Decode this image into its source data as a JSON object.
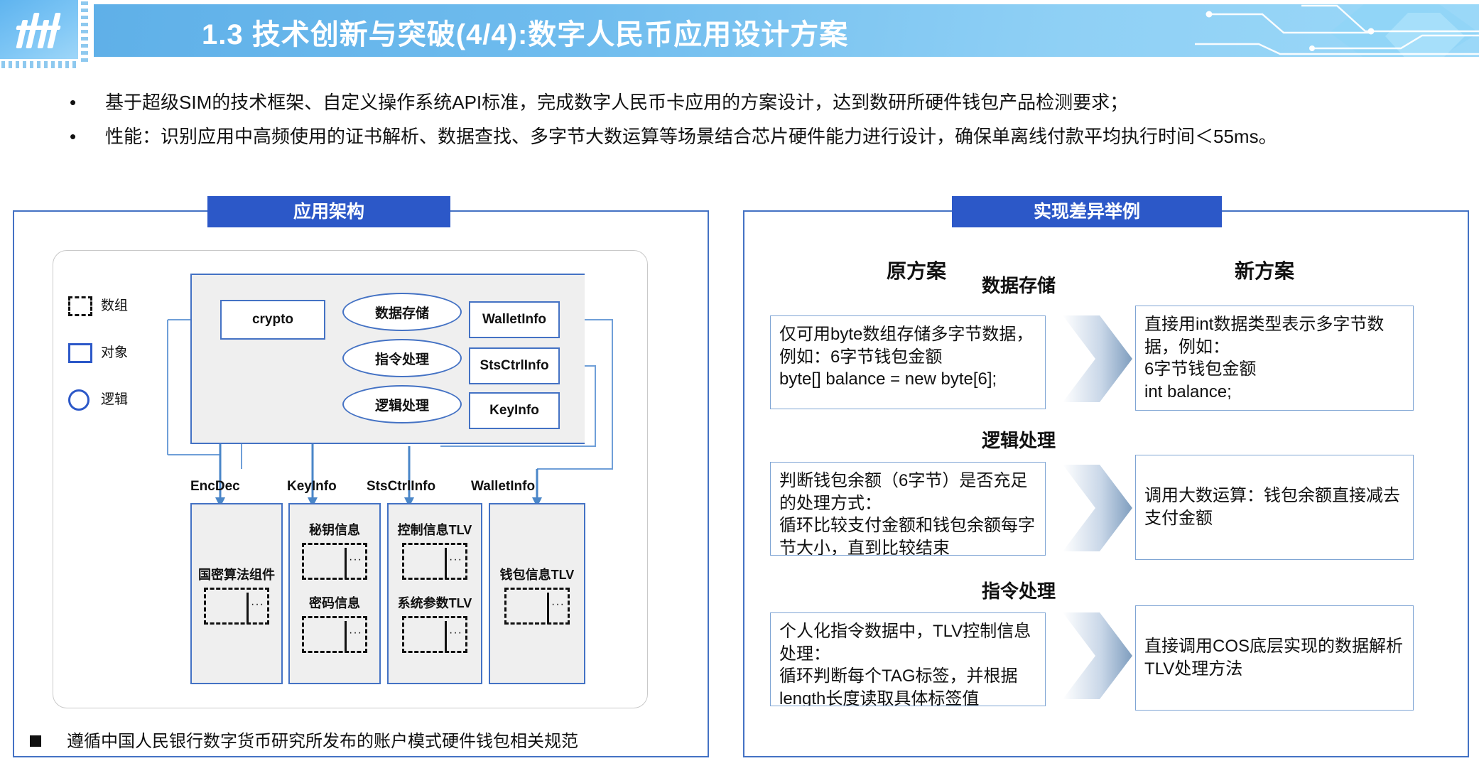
{
  "header": {
    "logo_icon": "brand-logo-icon",
    "title": "1.3 技术创新与突破(4/4):数字人民币应用设计方案",
    "decor_icon": "circuit-decoration-icon"
  },
  "bullets": [
    "基于超级SIM的技术框架、自定义操作系统API标准，完成数字人民币卡应用的方案设计，达到数研所硬件钱包产品检测要求；",
    "性能：识别应用中高频使用的证书解析、数据查找、多字节大数运算等场景结合芯片硬件能力进行设计，确保单离线付款平均执行时间＜55ms。"
  ],
  "left_panel": {
    "title": "应用架构",
    "legend": [
      {
        "symbol": "dashed-rect-icon",
        "label": "数组"
      },
      {
        "symbol": "solid-rect-icon",
        "label": "对象"
      },
      {
        "symbol": "circle-icon",
        "label": "逻辑"
      }
    ],
    "top_nodes": {
      "object_left": "crypto",
      "logic": [
        "数据存储",
        "指令处理",
        "逻辑处理"
      ],
      "objects_right": [
        "WalletInfo",
        "StsCtrlInfo",
        "KeyInfo"
      ]
    },
    "columns": [
      {
        "label": "EncDec",
        "items": [
          "国密算法组件"
        ]
      },
      {
        "label": "KeyInfo",
        "items": [
          "秘钥信息",
          "密码信息"
        ]
      },
      {
        "label": "StsCtrlInfo",
        "items": [
          "控制信息TLV",
          "系统参数TLV"
        ]
      },
      {
        "label": "WalletInfo",
        "items": [
          "钱包信息TLV"
        ]
      }
    ],
    "note": "遵循中国人民银行数字货币研究所发布的账户模式硬件钱包相关规范",
    "note_marker": "square-bullet-icon"
  },
  "right_panel": {
    "title": "实现差异举例",
    "col_headers": {
      "old": "原方案",
      "new": "新方案"
    },
    "rows": [
      {
        "mid_label": "数据存储",
        "arrow_icon": "chevron-right-arrow-icon",
        "old": "仅可用byte数组存储多字节数据，例如：6字节钱包金额\nbyte[] balance = new byte[6];",
        "new": "直接用int数据类型表示多字节数据，例如：\n6字节钱包金额\nint balance;"
      },
      {
        "mid_label": "逻辑处理",
        "arrow_icon": "chevron-right-arrow-icon",
        "old": "判断钱包余额（6字节）是否充足的处理方式：\n循环比较支付金额和钱包余额每字节大小，直到比较结束",
        "new": "调用大数运算：钱包余额直接减去支付金额"
      },
      {
        "mid_label": "指令处理",
        "arrow_icon": "chevron-right-arrow-icon",
        "old": "个人化指令数据中，TLV控制信息处理：\n循环判断每个TAG标签，并根据length长度读取具体标签值",
        "new": "直接调用COS底层实现的数据解析TLV处理方法"
      }
    ]
  },
  "colors": {
    "header_blue": "#6fbcee",
    "panel_title_blue": "#2c58c8",
    "panel_border": "#4472c4",
    "node_border": "#4472c4",
    "grey_fill": "#efefef",
    "text_box_border": "#7fa5d4"
  }
}
